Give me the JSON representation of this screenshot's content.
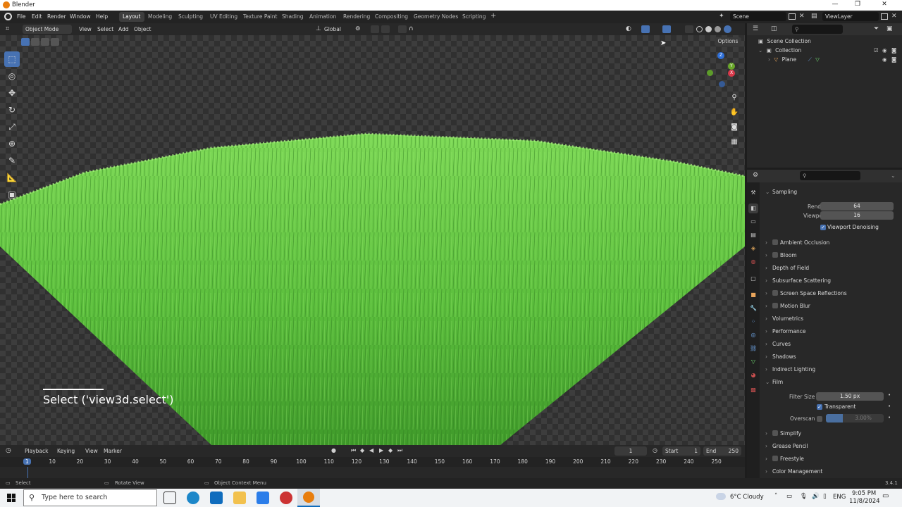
{
  "window": {
    "app_name": "Blender",
    "min": "—",
    "max": "❐",
    "close": "✕"
  },
  "menus": [
    "File",
    "Edit",
    "Render",
    "Window",
    "Help"
  ],
  "workspaces": [
    "Layout",
    "Modeling",
    "Sculpting",
    "UV Editing",
    "Texture Paint",
    "Shading",
    "Animation",
    "Rendering",
    "Compositing",
    "Geometry Nodes",
    "Scripting"
  ],
  "active_workspace": "Layout",
  "add_workspace": "+",
  "scene": {
    "scene_name": "Scene",
    "viewlayer_name": "ViewLayer"
  },
  "viewport_header": {
    "mode": "Object Mode",
    "menus": [
      "View",
      "Select",
      "Add",
      "Object"
    ],
    "orientation": "Global",
    "options": "Options"
  },
  "viewport": {
    "operator_message": "Select ('view3d.select')"
  },
  "gizmo": {
    "z": "Z",
    "y": "Y",
    "x": "X"
  },
  "outliner": {
    "rows": [
      {
        "label": "Scene Collection"
      },
      {
        "label": "Collection"
      },
      {
        "label": "Plane"
      }
    ]
  },
  "properties": {
    "sampling": {
      "title": "Sampling",
      "render_label": "Render",
      "render_value": "64",
      "viewport_label": "Viewport",
      "viewport_value": "16",
      "denoise_label": "Viewport Denoising"
    },
    "panels": [
      {
        "label": "Ambient Occlusion",
        "checkbox": true
      },
      {
        "label": "Bloom",
        "checkbox": true
      },
      {
        "label": "Depth of Field",
        "checkbox": false
      },
      {
        "label": "Subsurface Scattering",
        "checkbox": false
      },
      {
        "label": "Screen Space Reflections",
        "checkbox": true
      },
      {
        "label": "Motion Blur",
        "checkbox": true
      },
      {
        "label": "Volumetrics",
        "checkbox": false
      },
      {
        "label": "Performance",
        "checkbox": false
      },
      {
        "label": "Curves",
        "checkbox": false
      },
      {
        "label": "Shadows",
        "checkbox": false
      },
      {
        "label": "Indirect Lighting",
        "checkbox": false
      }
    ],
    "film": {
      "title": "Film",
      "filter_label": "Filter Size",
      "filter_value": "1.50 px",
      "transparent_label": "Transparent",
      "overscan_label": "Overscan",
      "overscan_value": "3.00%"
    },
    "panels_after": [
      {
        "label": "Simplify",
        "checkbox": true
      },
      {
        "label": "Grease Pencil",
        "checkbox": false
      },
      {
        "label": "Freestyle",
        "checkbox": true
      },
      {
        "label": "Color Management",
        "checkbox": false
      }
    ]
  },
  "timeline": {
    "menus": [
      "Playback",
      "Keying",
      "View",
      "Marker"
    ],
    "current_frame": "1",
    "start_label": "Start",
    "start_value": "1",
    "end_label": "End",
    "end_value": "250",
    "ticks": [
      "1",
      "10",
      "20",
      "30",
      "40",
      "50",
      "60",
      "70",
      "80",
      "90",
      "100",
      "110",
      "120",
      "130",
      "140",
      "150",
      "160",
      "170",
      "180",
      "190",
      "200",
      "210",
      "220",
      "230",
      "240",
      "250"
    ]
  },
  "statusbar": {
    "select": "Select",
    "rotate": "Rotate View",
    "context": "Object Context Menu",
    "version": "3.4.1"
  },
  "taskbar": {
    "search_placeholder": "Type here to search",
    "weather": "6°C  Cloudy",
    "lang": "ENG",
    "time": "9:05 PM",
    "date": "11/8/2024"
  },
  "colors": {
    "accent": "#4772b3",
    "grass_light": "#7ed957",
    "grass_dark": "#3f9a2a",
    "blender_orange": "#e87d0d"
  }
}
